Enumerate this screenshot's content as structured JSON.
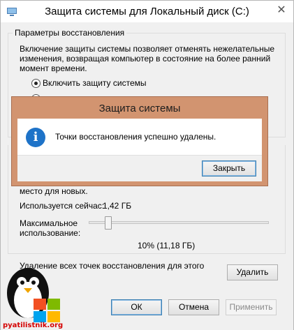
{
  "window": {
    "title": "Защита системы для Локальный диск (C:)",
    "close_glyph": "✕",
    "icon": "system-protection-icon"
  },
  "restore_settings": {
    "legend": "Параметры восстановления",
    "description_lines": [
      "Включение защиты системы позволяет отменять нежелательные",
      "изменения, возвращая компьютер в состояние на более ранний",
      "момент времени."
    ],
    "radio_enable_label": "Включить защиту системы",
    "radio_enable_checked": true
  },
  "disk_usage": {
    "text_fragment": "место для новых.",
    "used_now_label": "Используется сейчас:",
    "used_now_value": "1,42 ГБ",
    "max_usage_label_line1": "Максимальное",
    "max_usage_label_line2": "использование:",
    "slider_value_percent": 10,
    "slider_value_text": "10% (11,18 ГБ)"
  },
  "delete_section": {
    "text": "Удаление всех точек восстановления для этого",
    "delete_button": "Удалить"
  },
  "footer": {
    "ok": "ОК",
    "cancel": "Отмена",
    "apply": "Применить"
  },
  "dialog": {
    "title": "Защита системы",
    "message": "Точки восстановления успешно удалены.",
    "close_button": "Закрыть",
    "icon": "info-icon",
    "frame_color": "#d29470"
  },
  "watermark": {
    "text": "pyatilistnik.org"
  }
}
